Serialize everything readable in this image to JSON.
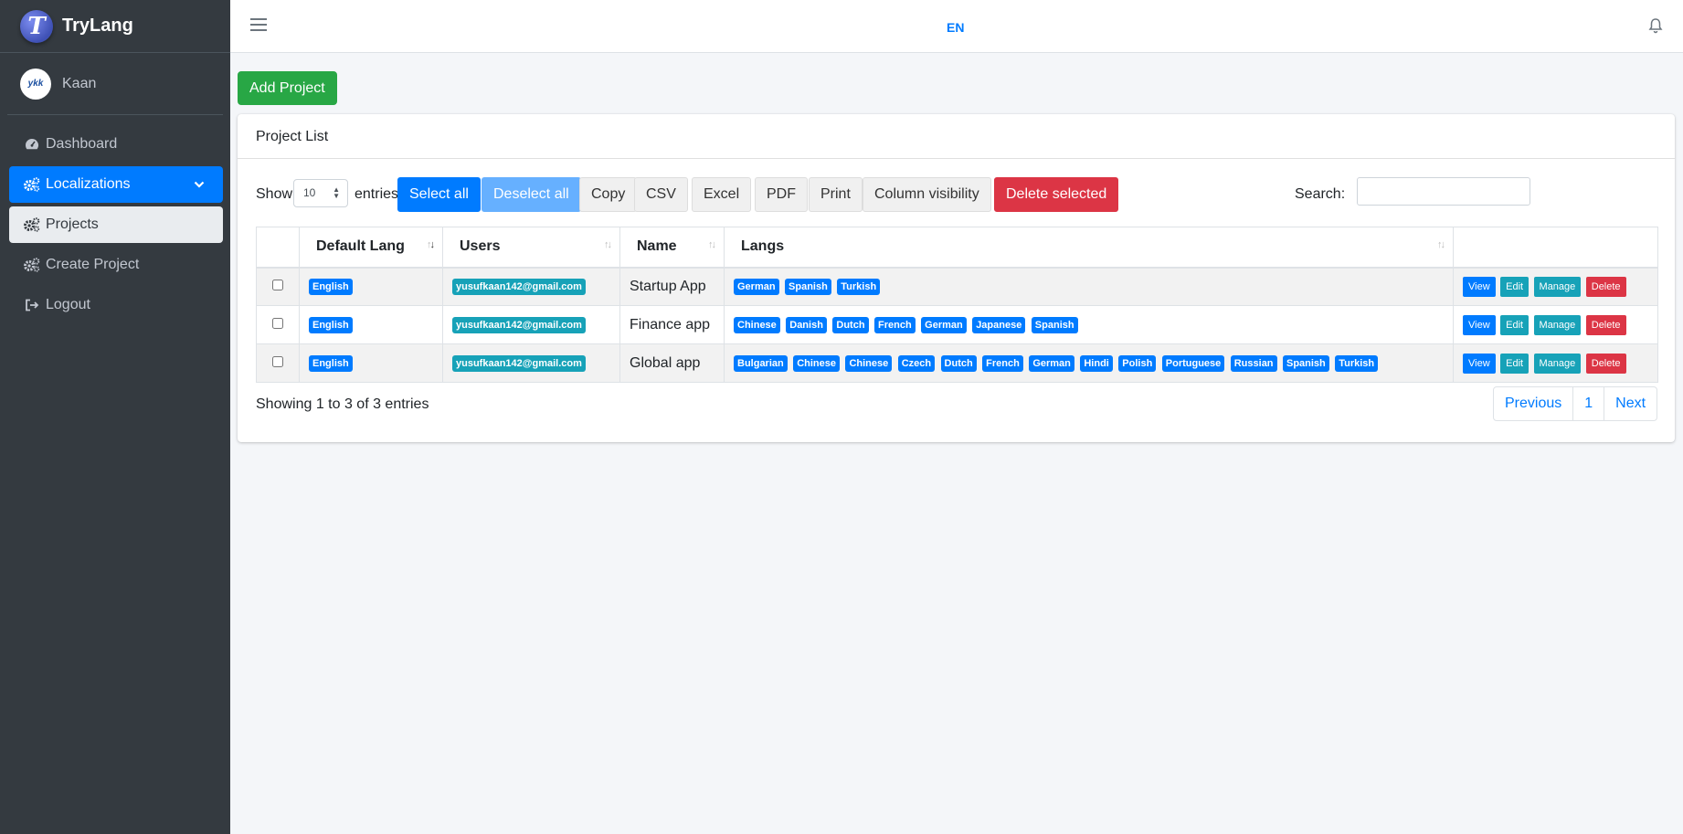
{
  "brand": {
    "logo_letter": "T",
    "name": "TryLang"
  },
  "user": {
    "avatar_text": "ykk",
    "name": "Kaan"
  },
  "sidebar": {
    "items": [
      {
        "label": "Dashboard",
        "icon": "tachometer-icon"
      },
      {
        "label": "Localizations",
        "icon": "cogs-icon",
        "state": "active"
      },
      {
        "label": "Projects",
        "icon": "cogs-icon",
        "state": "open"
      },
      {
        "label": "Create Project",
        "icon": "cogs-icon"
      },
      {
        "label": "Logout",
        "icon": "sign-out-icon"
      }
    ]
  },
  "topbar": {
    "lang": "EN"
  },
  "main": {
    "add_button": "Add Project",
    "card_title": "Project List",
    "show": "Show",
    "length_value": "10",
    "entries": "entries",
    "buttons": {
      "select_all": "Select all",
      "deselect_all": "Deselect all",
      "copy": "Copy",
      "csv": "CSV",
      "excel": "Excel",
      "pdf": "PDF",
      "print": "Print",
      "column_visibility": "Column visibility",
      "delete_selected": "Delete selected"
    },
    "search_label": "Search:",
    "search_value": ""
  },
  "table": {
    "headers": [
      "Default Lang",
      "Users",
      "Name",
      "Langs"
    ],
    "rows": [
      {
        "default_lang": "English",
        "user": "yusufkaan142@gmail.com",
        "name": "Startup App",
        "langs": [
          "German",
          "Spanish",
          "Turkish"
        ]
      },
      {
        "default_lang": "English",
        "user": "yusufkaan142@gmail.com",
        "name": "Finance app",
        "langs": [
          "Chinese",
          "Danish",
          "Dutch",
          "French",
          "German",
          "Japanese",
          "Spanish"
        ]
      },
      {
        "default_lang": "English",
        "user": "yusufkaan142@gmail.com",
        "name": "Global app",
        "langs": [
          "Bulgarian",
          "Chinese",
          "Chinese",
          "Czech",
          "Dutch",
          "French",
          "German",
          "Hindi",
          "Polish",
          "Portuguese",
          "Russian",
          "Spanish",
          "Turkish"
        ]
      }
    ],
    "actions": {
      "view": "View",
      "edit": "Edit",
      "manage": "Manage",
      "delete": "Delete"
    }
  },
  "footer": {
    "info": "Showing 1 to 3 of 3 entries",
    "pagination": {
      "previous": "Previous",
      "page": "1",
      "next": "Next"
    }
  },
  "colors": {
    "primary": "#007bff",
    "success": "#28a745",
    "danger": "#dc3545",
    "info": "#17a2b8",
    "sidebar": "#343a40"
  }
}
